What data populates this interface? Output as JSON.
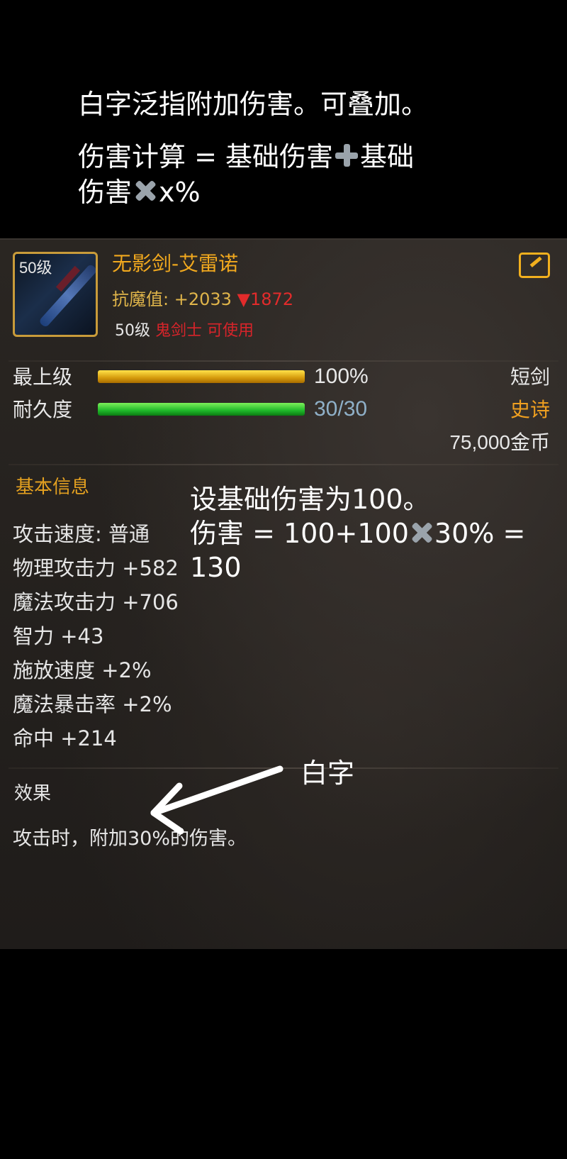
{
  "caption": {
    "line1": "白字泛指附加伤害。可叠加。",
    "line2a": "伤害计算 = 基础伤害",
    "line2b": "基础",
    "line3a": "伤害",
    "line3b": "x%"
  },
  "item": {
    "icon_level": "50级",
    "name": "无影剑-艾雷诺",
    "resist_label": "抗魔值: ",
    "resist_value": "+2033",
    "resist_down": "▼1872",
    "req_level": "50级",
    "req_class": "鬼剑士 可使用",
    "stats": [
      {
        "label": "最上级",
        "value": "100%",
        "fill": 1.0,
        "right": "短剑"
      },
      {
        "label": "耐久度",
        "value": "30/30",
        "fill": 1.0,
        "right": "史诗"
      }
    ],
    "price": "75,000金币",
    "basic_title": "基本信息",
    "attributes": [
      "攻击速度: 普通",
      "物理攻击力 +582",
      "魔法攻击力 +706",
      "智力 +43",
      "施放速度 +2%",
      "魔法暴击率 +2%",
      "命中 +214"
    ],
    "effect_title": "效果",
    "effect_text": "攻击时，附加30%的伤害。"
  },
  "annotation": {
    "line1": "设基础伤害为100。",
    "line2a": "伤害 = 100+100",
    "line2b": "30% =",
    "line3": "130",
    "arrow_label": "白字"
  },
  "colors": {
    "gold": "#f2a91e",
    "epic": "#f0a020",
    "red": "#d8242a",
    "bar_gold": "#e6b020",
    "bar_green": "#22c02c",
    "durability_text": "#8fb0c8"
  },
  "icons": {
    "share": "share-icon",
    "plus": "plus-emoji",
    "multiply": "multiply-emoji",
    "arrow": "arrow-icon"
  }
}
